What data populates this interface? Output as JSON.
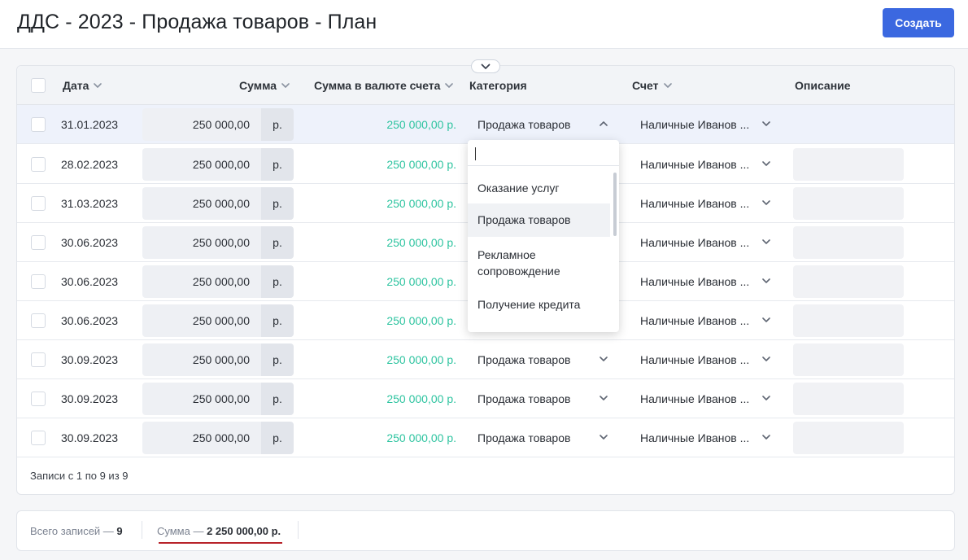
{
  "header": {
    "title": "ДДС - 2023 - Продажа товаров - План",
    "create_label": "Создать"
  },
  "table": {
    "columns": {
      "date": "Дата",
      "amount": "Сумма",
      "account_amount": "Сумма в валюте счета",
      "category": "Категория",
      "account": "Счет",
      "description": "Описание"
    },
    "rows": [
      {
        "date": "31.01.2023",
        "amount": "250 000,00",
        "currency": "р.",
        "account_amount": "250 000,00 р.",
        "category": "Продажа товаров",
        "account": "Наличные Иванов ...",
        "description": ""
      },
      {
        "date": "28.02.2023",
        "amount": "250 000,00",
        "currency": "р.",
        "account_amount": "250 000,00 р.",
        "category": "",
        "account": "Наличные Иванов ...",
        "description": ""
      },
      {
        "date": "31.03.2023",
        "amount": "250 000,00",
        "currency": "р.",
        "account_amount": "250 000,00 р.",
        "category": "",
        "account": "Наличные Иванов ...",
        "description": ""
      },
      {
        "date": "30.06.2023",
        "amount": "250 000,00",
        "currency": "р.",
        "account_amount": "250 000,00 р.",
        "category": "",
        "account": "Наличные Иванов ...",
        "description": ""
      },
      {
        "date": "30.06.2023",
        "amount": "250 000,00",
        "currency": "р.",
        "account_amount": "250 000,00 р.",
        "category": "",
        "account": "Наличные Иванов ...",
        "description": ""
      },
      {
        "date": "30.06.2023",
        "amount": "250 000,00",
        "currency": "р.",
        "account_amount": "250 000,00 р.",
        "category": "",
        "account": "Наличные Иванов ...",
        "description": ""
      },
      {
        "date": "30.09.2023",
        "amount": "250 000,00",
        "currency": "р.",
        "account_amount": "250 000,00 р.",
        "category": "Продажа товаров",
        "account": "Наличные Иванов ...",
        "description": ""
      },
      {
        "date": "30.09.2023",
        "amount": "250 000,00",
        "currency": "р.",
        "account_amount": "250 000,00 р.",
        "category": "Продажа товаров",
        "account": "Наличные Иванов ...",
        "description": ""
      },
      {
        "date": "30.09.2023",
        "amount": "250 000,00",
        "currency": "р.",
        "account_amount": "250 000,00 р.",
        "category": "Продажа товаров",
        "account": "Наличные Иванов ...",
        "description": ""
      }
    ],
    "records_info": "Записи с 1 по 9 из 9"
  },
  "category_dropdown": {
    "search_value": "",
    "options": [
      "Оказание услуг",
      "Продажа товаров",
      "Рекламное сопровождение",
      "Получение кредита"
    ],
    "selected": "Продажа товаров"
  },
  "footer": {
    "total_label": "Всего записей — ",
    "total_value": "9",
    "sum_label": "Сумма — ",
    "sum_value": "2 250 000,00 р."
  },
  "colors": {
    "primary": "#3b68e0",
    "account_amount_text": "#2ec4a0",
    "sum_underline": "#b8232a"
  },
  "icons": {
    "sort": "chevron-down-icon",
    "category_open": "chevron-up-icon",
    "collapse_toggle": "chevron-down-icon"
  }
}
